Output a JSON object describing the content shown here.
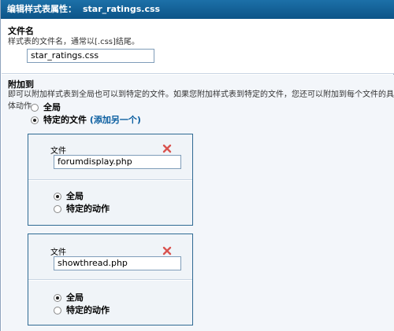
{
  "header": {
    "title_label": "编辑样式表属性：",
    "title_value": "star_ratings.css"
  },
  "filename_section": {
    "heading": "文件名",
    "description": "样式表的文件名，通常以[.css]结尾。",
    "value": "star_ratings.css"
  },
  "attach_section": {
    "heading": "附加到",
    "description": "即可以附加样式表到全局也可以到特定的文件。如果您附加样式表到特定的文件，您还可以附加到每个文件的具体动作。",
    "options": [
      {
        "label": "全局",
        "checked": false
      },
      {
        "label": "特定的文件",
        "add_link": "(添加另一个)",
        "checked": true
      }
    ]
  },
  "files": [
    {
      "label": "文件",
      "value": "forumdisplay.php",
      "actions": [
        {
          "label": "全局",
          "checked": true
        },
        {
          "label": "特定的动作",
          "checked": false
        }
      ]
    },
    {
      "label": "文件",
      "value": "showthread.php",
      "actions": [
        {
          "label": "全局",
          "checked": true
        },
        {
          "label": "特定的动作",
          "checked": false
        }
      ]
    }
  ],
  "colors": {
    "title_bar": "#0f5e96",
    "link": "#0a5ea0",
    "delete_icon": "#d9534f",
    "box_border": "#2f6a93"
  },
  "icons": {
    "delete": "close-icon"
  }
}
